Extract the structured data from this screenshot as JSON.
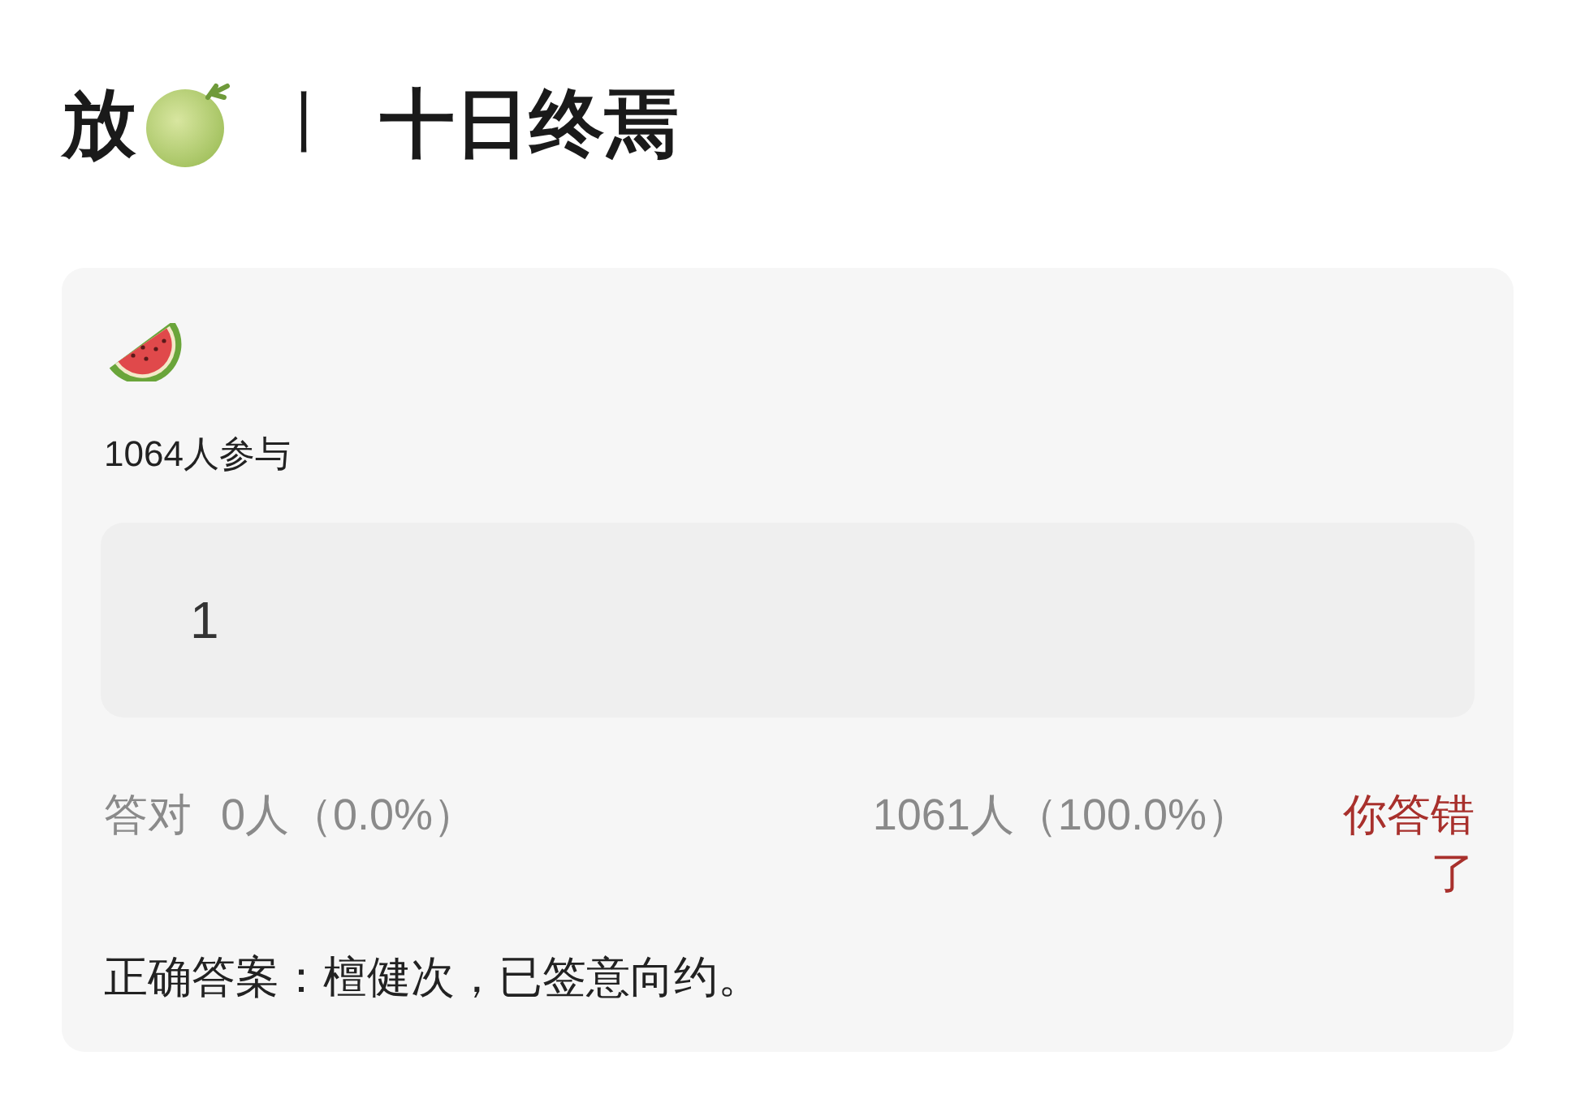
{
  "title": {
    "lead": "放",
    "separator": "丨",
    "name": "十日终焉"
  },
  "quiz": {
    "participants": "1064人参与",
    "answer": {
      "value": "1"
    },
    "results": {
      "correct_label": "答对",
      "correct_count": "0人（0.0%）",
      "wrong_count": "1061人（100.0%）",
      "verdict": "你答错了"
    },
    "correct_answer": "正确答案：檀健次，已签意向约。"
  }
}
